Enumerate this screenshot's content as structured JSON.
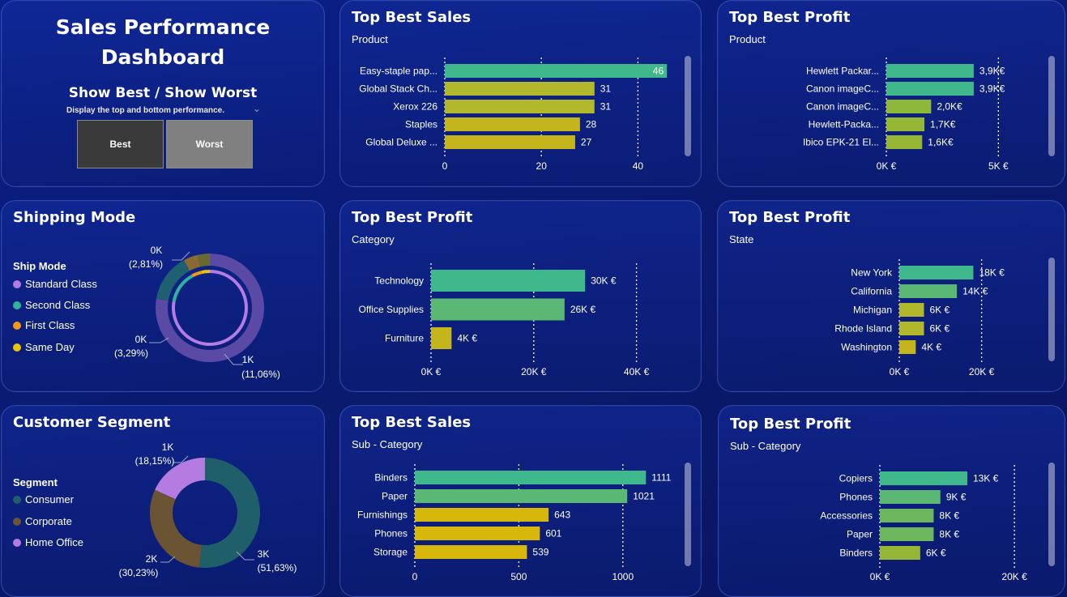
{
  "header": {
    "title_line1": "Sales Performance",
    "title_line2": "Dashboard",
    "toggle_title": "Show Best / Show Worst",
    "toggle_desc": "Display the top and bottom performance.",
    "best_label": "Best",
    "worst_label": "Worst"
  },
  "shipping": {
    "title": "Shipping Mode",
    "legend_title": "Ship Mode",
    "items": [
      {
        "label": "Standard Class",
        "color": "#b47be0"
      },
      {
        "label": "Second Class",
        "color": "#2fb39a"
      },
      {
        "label": "First Class",
        "color": "#f29a16"
      },
      {
        "label": "Same Day",
        "color": "#e8c40c"
      }
    ],
    "label_top": "0K",
    "label_top_pct": "(2,81%)",
    "label_left": "0K",
    "label_left_pct": "(3,29%)",
    "label_bottom": "1K",
    "label_bottom_pct": "(11,06%)"
  },
  "segment": {
    "title": "Customer Segment",
    "legend_title": "Segment",
    "items": [
      {
        "label": "Consumer",
        "color": "#1f5f6a"
      },
      {
        "label": "Corporate",
        "color": "#6b5434"
      },
      {
        "label": "Home Office",
        "color": "#b47be0"
      }
    ],
    "label_top": "1K",
    "label_top_pct": "(18,15%)",
    "label_left": "2K",
    "label_left_pct": "(30,23%)",
    "label_right": "3K",
    "label_right_pct": "(51,63%)"
  },
  "chart_data": [
    {
      "id": "sales-product",
      "type": "bar",
      "title": "Top Best Sales",
      "subtitle": "Product",
      "categories": [
        "Easy-staple pap...",
        "Global Stack Ch...",
        "Xerox 226",
        "Staples",
        "Global Deluxe ..."
      ],
      "values": [
        46,
        31,
        31,
        28,
        27
      ],
      "value_labels": [
        "46",
        "31",
        "31",
        "28",
        "27"
      ],
      "colors": [
        "#3fb88c",
        "#b2b82c",
        "#b2b82c",
        "#c4b51d",
        "#c4b51d"
      ],
      "xlim": [
        0,
        50
      ],
      "ticks": [
        0,
        20,
        40
      ],
      "tick_labels": [
        "0",
        "20",
        "40"
      ]
    },
    {
      "id": "profit-product",
      "type": "bar",
      "title": "Top Best Profit",
      "subtitle": "Product",
      "categories": [
        "Hewlett Packar...",
        "Canon imageC...",
        "Canon imageC...",
        "Hewlett-Packa...",
        "Ibico EPK-21 El..."
      ],
      "values": [
        3.9,
        3.9,
        2.0,
        1.7,
        1.6
      ],
      "value_labels": [
        "3,9K€",
        "3,9K€",
        "2,0K€",
        "1,7K€",
        "1,6K€"
      ],
      "colors": [
        "#3fb88c",
        "#3fb88c",
        "#8db83a",
        "#96b735",
        "#96b735"
      ],
      "xlim": [
        0,
        6
      ],
      "ticks": [
        0,
        5
      ],
      "tick_labels": [
        "0K €",
        "5K €"
      ]
    },
    {
      "id": "profit-category",
      "type": "bar",
      "title": "Top Best Profit",
      "subtitle": "Category",
      "categories": [
        "Technology",
        "Office Supplies",
        "Furniture"
      ],
      "values": [
        30,
        26,
        4
      ],
      "value_labels": [
        "30K €",
        "26K €",
        "4K €"
      ],
      "colors": [
        "#3fb88c",
        "#5bb874",
        "#c4b51d"
      ],
      "xlim": [
        0,
        50
      ],
      "ticks": [
        0,
        20,
        40
      ],
      "tick_labels": [
        "0K €",
        "20K €",
        "40K €"
      ]
    },
    {
      "id": "profit-state",
      "type": "bar",
      "title": "Top Best Profit",
      "subtitle": "State",
      "categories": [
        "New York",
        "California",
        "Michigan",
        "Rhode Island",
        "Washington"
      ],
      "values": [
        18,
        14,
        6,
        6,
        4
      ],
      "value_labels": [
        "18K €",
        "14K €",
        "6K €",
        "6K €",
        "4K €"
      ],
      "colors": [
        "#3fb88c",
        "#5bb874",
        "#b2b82c",
        "#b2b82c",
        "#c4b51d"
      ],
      "xlim": [
        0,
        25
      ],
      "ticks": [
        0,
        20
      ],
      "tick_labels": [
        "0K €",
        "20K €"
      ]
    },
    {
      "id": "sales-subcategory",
      "type": "bar",
      "title": "Top Best Sales",
      "subtitle": "Sub - Category",
      "categories": [
        "Binders",
        "Paper",
        "Furnishings",
        "Phones",
        "Storage"
      ],
      "values": [
        1111,
        1021,
        643,
        601,
        539
      ],
      "value_labels": [
        "1111",
        "1021",
        "643",
        "601",
        "539"
      ],
      "colors": [
        "#3fb88c",
        "#5bb874",
        "#d8b70c",
        "#d8b70c",
        "#d8b70c"
      ],
      "xlim": [
        0,
        1250
      ],
      "ticks": [
        0,
        500,
        1000
      ],
      "tick_labels": [
        "0",
        "500",
        "1000"
      ]
    },
    {
      "id": "profit-subcategory",
      "type": "bar",
      "title": "Top Best Profit",
      "subtitle": "Sub - Category",
      "categories": [
        "Copiers",
        "Phones",
        "Accessories",
        "Paper",
        "Binders"
      ],
      "values": [
        13,
        9,
        8,
        8,
        6
      ],
      "value_labels": [
        "13K €",
        "9K €",
        "8K €",
        "8K €",
        "6K €"
      ],
      "colors": [
        "#3fb88c",
        "#5bb874",
        "#6cb65e",
        "#6cb65e",
        "#96b735"
      ],
      "xlim": [
        0,
        23
      ],
      "ticks": [
        0,
        20
      ],
      "tick_labels": [
        "0K €",
        "20K €"
      ]
    },
    {
      "id": "shipping-donut",
      "type": "pie",
      "title": "Shipping Mode",
      "categories": [
        "Standard Class",
        "Second Class",
        "First Class",
        "Same Day"
      ],
      "values": [
        59.8,
        11.06,
        3.29,
        2.81
      ],
      "colors": [
        "#b47be0",
        "#2fb39a",
        "#f29a16",
        "#e8c40c"
      ]
    },
    {
      "id": "segment-donut",
      "type": "pie",
      "title": "Customer Segment",
      "categories": [
        "Consumer",
        "Corporate",
        "Home Office"
      ],
      "values": [
        51.63,
        30.23,
        18.15
      ],
      "colors": [
        "#1f5f6a",
        "#6b5434",
        "#b47be0"
      ]
    }
  ]
}
